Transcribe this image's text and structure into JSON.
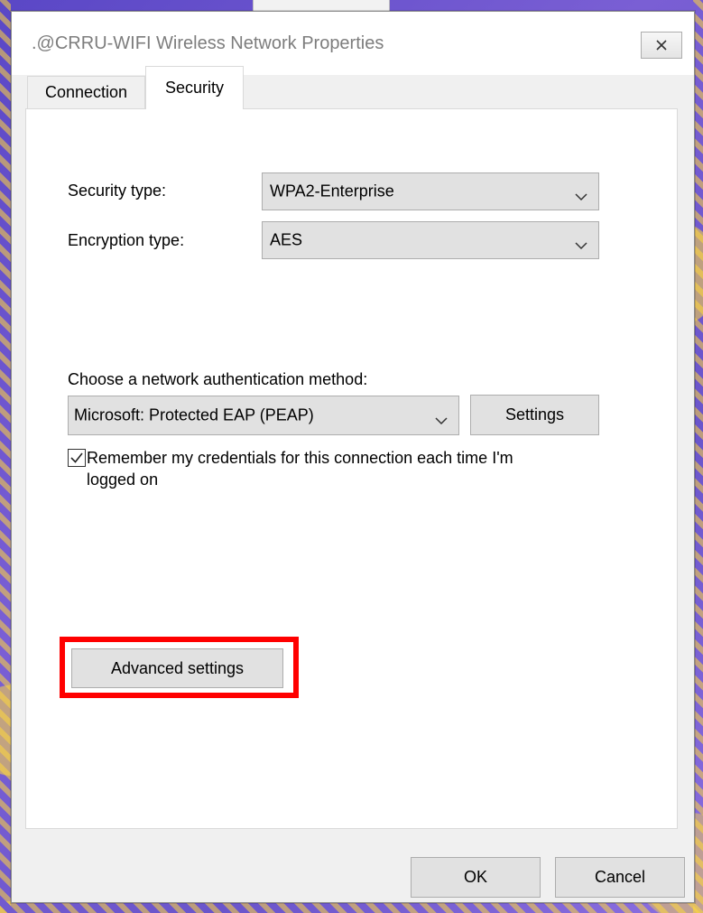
{
  "window": {
    "title": ".@CRRU-WIFI Wireless Network Properties",
    "close_icon": "close-icon"
  },
  "tabs": [
    {
      "label": "Connection",
      "selected": false
    },
    {
      "label": "Security",
      "selected": true
    }
  ],
  "security": {
    "security_type_label": "Security type:",
    "security_type_value": "WPA2-Enterprise",
    "encryption_type_label": "Encryption type:",
    "encryption_type_value": "AES",
    "auth_method_label": "Choose a network authentication method:",
    "auth_method_value": "Microsoft: Protected EAP (PEAP)",
    "settings_button": "Settings",
    "remember_credentials_label": "Remember my credentials for this connection each time I'm logged on",
    "remember_credentials_checked": true,
    "advanced_settings_button": "Advanced settings"
  },
  "footer": {
    "ok_button": "OK",
    "cancel_button": "Cancel"
  },
  "colors": {
    "highlight": "#ff0000",
    "dialog_bg": "#f0f0f0",
    "panel_bg": "#ffffff",
    "button_bg": "#e1e1e1"
  }
}
